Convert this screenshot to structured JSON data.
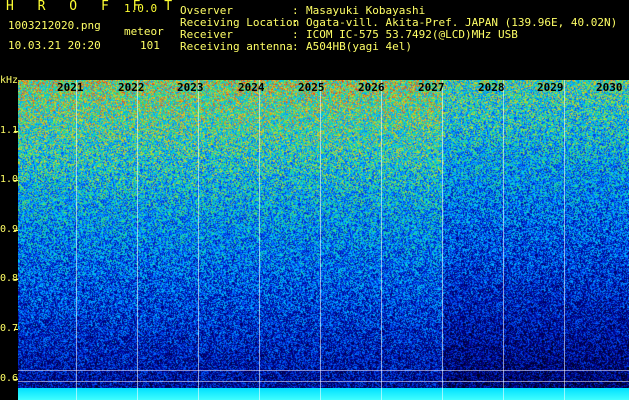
{
  "app": {
    "title": "H R O F F T",
    "version": "1.0.0"
  },
  "file": {
    "name": "1003212020.png",
    "datetime": "10.03.21 20:20",
    "mode": "meteor",
    "count": "101"
  },
  "info": [
    {
      "label": "Ovserver",
      "value": "Masayuki Kobayashi"
    },
    {
      "label": "Receiving Location",
      "value": "Ogata-vill. Akita-Pref. JAPAN (139.96E, 40.02N)"
    },
    {
      "label": "Receiver",
      "value": "ICOM IC-575 53.7492(@LCD)MHz USB"
    },
    {
      "label": "Receiving antenna",
      "value": "A504HB(yagi 4el)"
    }
  ],
  "axis": {
    "unit": "kHz",
    "ticks": [
      "1.1",
      "1.0",
      "0.9",
      "0.8",
      "0.7",
      "0.6"
    ]
  },
  "minutes": [
    "2021",
    "2022",
    "2023",
    "2024",
    "2025",
    "2026",
    "2027",
    "2028",
    "2029",
    "2030"
  ],
  "colors": {
    "label": "#ffff66",
    "background": "#000000"
  }
}
